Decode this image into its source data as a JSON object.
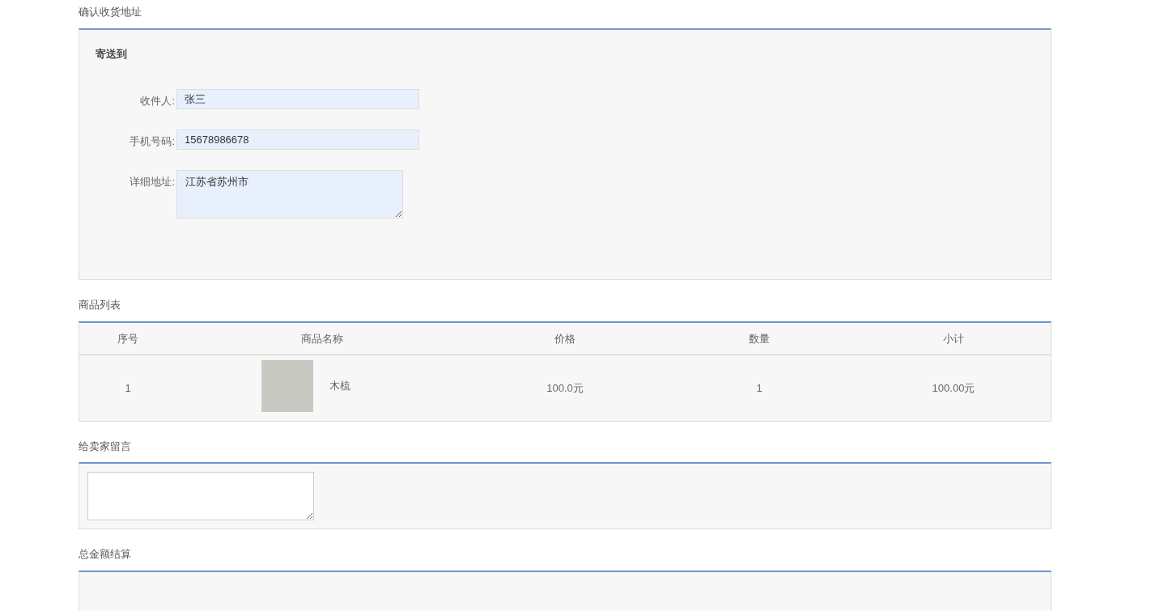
{
  "address_section": {
    "title": "确认收货地址",
    "subtitle": "寄送到",
    "fields": [
      {
        "kind": "input",
        "label": "收件人:",
        "value": "张三"
      },
      {
        "kind": "input",
        "label": "手机号码:",
        "value": "15678986678"
      },
      {
        "kind": "textarea",
        "label": "详细地址:",
        "value": "江苏省苏州市"
      }
    ]
  },
  "product_section": {
    "title": "商品列表",
    "table": {
      "columns": [
        "序号",
        "商品名称",
        "价格",
        "数量",
        "小计"
      ],
      "rows": [
        {
          "index": "1",
          "name": "木梳",
          "price": "100.0元",
          "quantity": "1",
          "subtotal": "100.00元"
        }
      ]
    }
  },
  "message_section": {
    "title": "给卖家留言"
  },
  "total_section": {
    "title": "总金额结算"
  }
}
